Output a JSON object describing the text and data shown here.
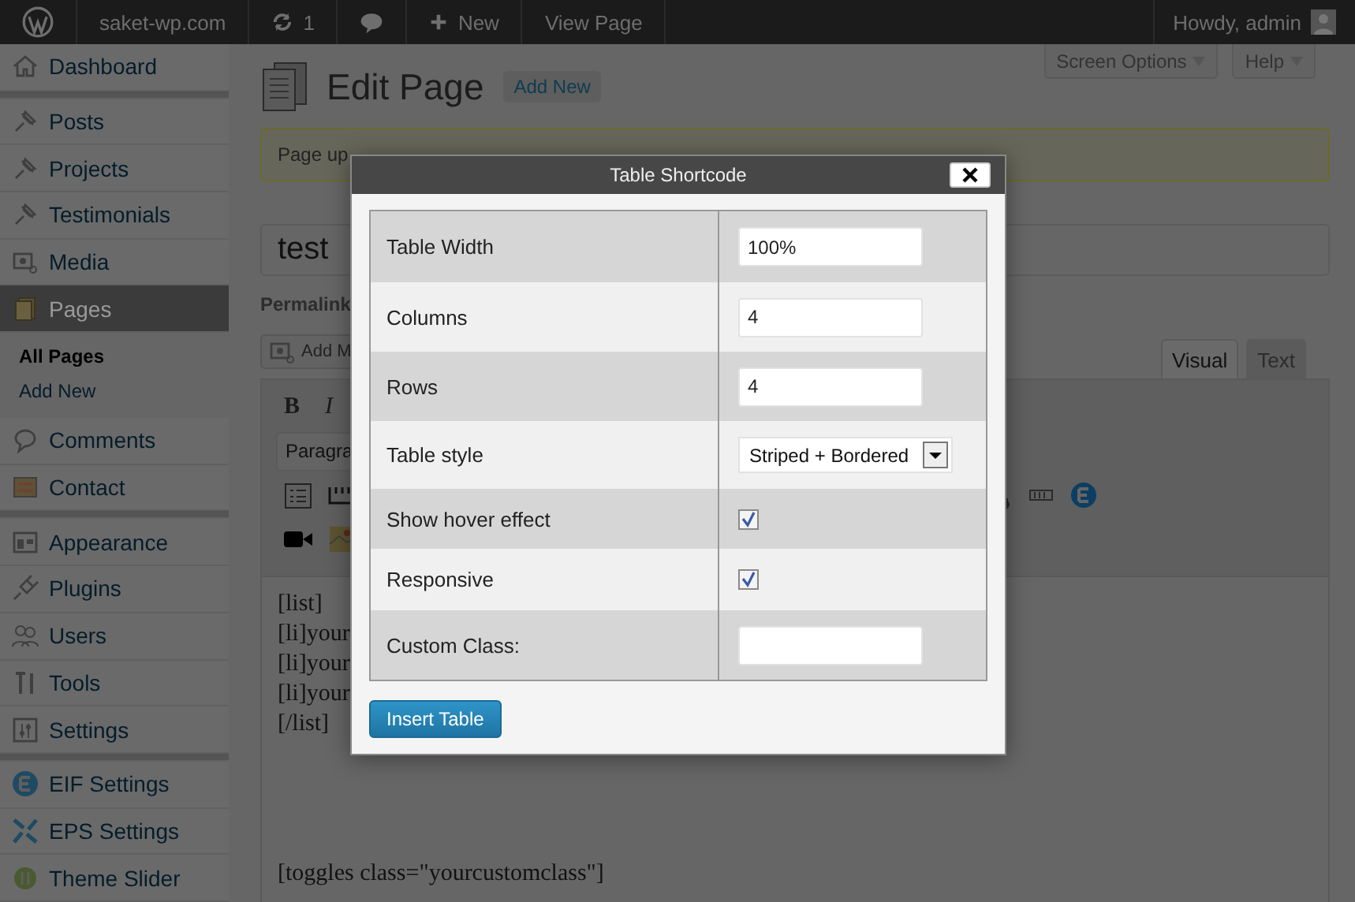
{
  "admin_bar": {
    "items": [
      {
        "kind": "logo"
      },
      {
        "kind": "text",
        "label": "saket-wp.com"
      },
      {
        "kind": "updates",
        "label": "1"
      },
      {
        "kind": "comments"
      },
      {
        "kind": "new",
        "label": "New"
      },
      {
        "kind": "text",
        "label": "View Page"
      }
    ],
    "account": "Howdy, admin"
  },
  "sidebar": {
    "groups": [
      [
        {
          "label": "Dashboard",
          "selected": false
        }
      ],
      [
        {
          "label": "Posts",
          "selected": false
        },
        {
          "label": "Projects",
          "selected": false
        },
        {
          "label": "Testimonials",
          "selected": false
        },
        {
          "label": "Media",
          "selected": false
        },
        {
          "label": "Pages",
          "selected": true,
          "children": [
            {
              "label": "All Pages",
              "selected": true
            },
            {
              "label": "Add New",
              "selected": false
            }
          ]
        },
        {
          "label": "Comments",
          "selected": false
        },
        {
          "label": "Contact",
          "selected": false
        }
      ],
      [
        {
          "label": "Appearance",
          "selected": false
        },
        {
          "label": "Plugins",
          "selected": false
        },
        {
          "label": "Users",
          "selected": false
        },
        {
          "label": "Tools",
          "selected": false
        },
        {
          "label": "Settings",
          "selected": false
        }
      ],
      [
        {
          "label": "EIF Settings",
          "selected": false
        },
        {
          "label": "EPS Settings",
          "selected": false
        },
        {
          "label": "Theme Slider",
          "selected": false
        }
      ]
    ]
  },
  "header": {
    "title": "Edit Page",
    "add_new": "Add New",
    "screen_options": "Screen Options",
    "help": "Help"
  },
  "notice": "Page up",
  "post_title": "test",
  "permalink": "Permalink",
  "add_media": "Add M",
  "editor_tabs": [
    {
      "label": "Visual",
      "selected": true
    },
    {
      "label": "Text",
      "selected": false
    }
  ],
  "toolbar": {
    "bold": "B",
    "italic": "I",
    "format": "Paragra"
  },
  "content": {
    "lines": [
      "[list]",
      "[li]your",
      "[li]your",
      "[li]your",
      "[/list]"
    ],
    "after": [
      "[toggles class=\"yourcustomclass\"]"
    ]
  },
  "dialog": {
    "title": "Table Shortcode",
    "fields": [
      {
        "kind": "text",
        "label": "Table Width",
        "value": "100%"
      },
      {
        "kind": "text",
        "label": "Columns",
        "value": "4"
      },
      {
        "kind": "text",
        "label": "Rows",
        "value": "4"
      },
      {
        "kind": "select",
        "label": "Table style",
        "value": "Striped + Bordered"
      },
      {
        "kind": "checkbox",
        "label": "Show hover effect",
        "checked": true
      },
      {
        "kind": "checkbox",
        "label": "Responsive",
        "checked": true
      },
      {
        "kind": "text",
        "label": "Custom Class:"
      }
    ],
    "submit": "Insert Table"
  }
}
